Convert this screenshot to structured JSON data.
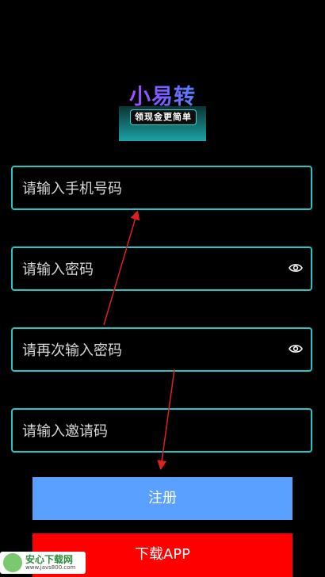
{
  "logo": {
    "title": "小易转",
    "tagline": "领现金更简单"
  },
  "form": {
    "phone_placeholder": "请输入手机号码",
    "password_placeholder": "请输入密码",
    "confirm_password_placeholder": "请再次输入密码",
    "invite_code_placeholder": "请输入邀请码"
  },
  "buttons": {
    "register_label": "注册",
    "download_label": "下载APP"
  },
  "watermark": {
    "name": "安心下载网",
    "url": "www.javs800.com"
  },
  "colors": {
    "background": "#000000",
    "field_border": "#24c6c8",
    "register_button": "#5aa0ff",
    "download_button": "#ff0000",
    "annotation_arrow": "#e0201c"
  }
}
